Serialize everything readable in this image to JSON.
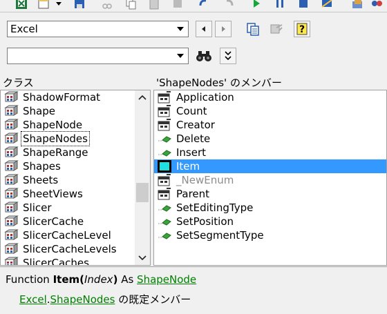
{
  "toolbar": {
    "icons": [
      "excel-icon",
      "insert-module-icon",
      "dropdown-icon",
      "save-icon",
      "cut-icon",
      "copy-icon",
      "paste-icon",
      "find-icon",
      "undo-icon",
      "redo-icon",
      "run-icon",
      "break-icon",
      "reset-icon",
      "design-mode-icon",
      "project-explorer-icon"
    ]
  },
  "library_select": {
    "value": "Excel"
  },
  "search_input": {
    "value": ""
  },
  "left_pane": {
    "header": "クラス",
    "items": [
      {
        "label": "ShadowFormat"
      },
      {
        "label": "Shape"
      },
      {
        "label": "ShapeNode"
      },
      {
        "label": "ShapeNodes"
      },
      {
        "label": "ShapeRange"
      },
      {
        "label": "Shapes"
      },
      {
        "label": "Sheets"
      },
      {
        "label": "SheetViews"
      },
      {
        "label": "Slicer"
      },
      {
        "label": "SlicerCache"
      },
      {
        "label": "SlicerCacheLevel"
      },
      {
        "label": "SlicerCacheLevels"
      },
      {
        "label": "SlicerCaches"
      }
    ]
  },
  "right_pane": {
    "header": "'ShapeNodes' のメンバー",
    "items": [
      {
        "label": "Application",
        "kind": "property"
      },
      {
        "label": "Count",
        "kind": "property"
      },
      {
        "label": "Creator",
        "kind": "property"
      },
      {
        "label": "Delete",
        "kind": "method"
      },
      {
        "label": "Insert",
        "kind": "method"
      },
      {
        "label": "Item",
        "kind": "default"
      },
      {
        "label": "_NewEnum",
        "kind": "hidden"
      },
      {
        "label": "Parent",
        "kind": "property"
      },
      {
        "label": "SetEditingType",
        "kind": "method"
      },
      {
        "label": "SetPosition",
        "kind": "method"
      },
      {
        "label": "SetSegmentType",
        "kind": "method"
      }
    ]
  },
  "details": {
    "line1_prefix": "Function ",
    "func_name": "Item",
    "paren_open": "(",
    "param": "Index",
    "paren_close": ")",
    "as_text": " As ",
    "return_type": "ShapeNode",
    "lib_link": "Excel",
    "dot": ".",
    "class_link": "ShapeNodes",
    "line2_suffix": " の既定メンバー"
  },
  "colors": {
    "selection": "#3399ff",
    "link": "#008000",
    "hidden_text": "#8c8c8c"
  }
}
